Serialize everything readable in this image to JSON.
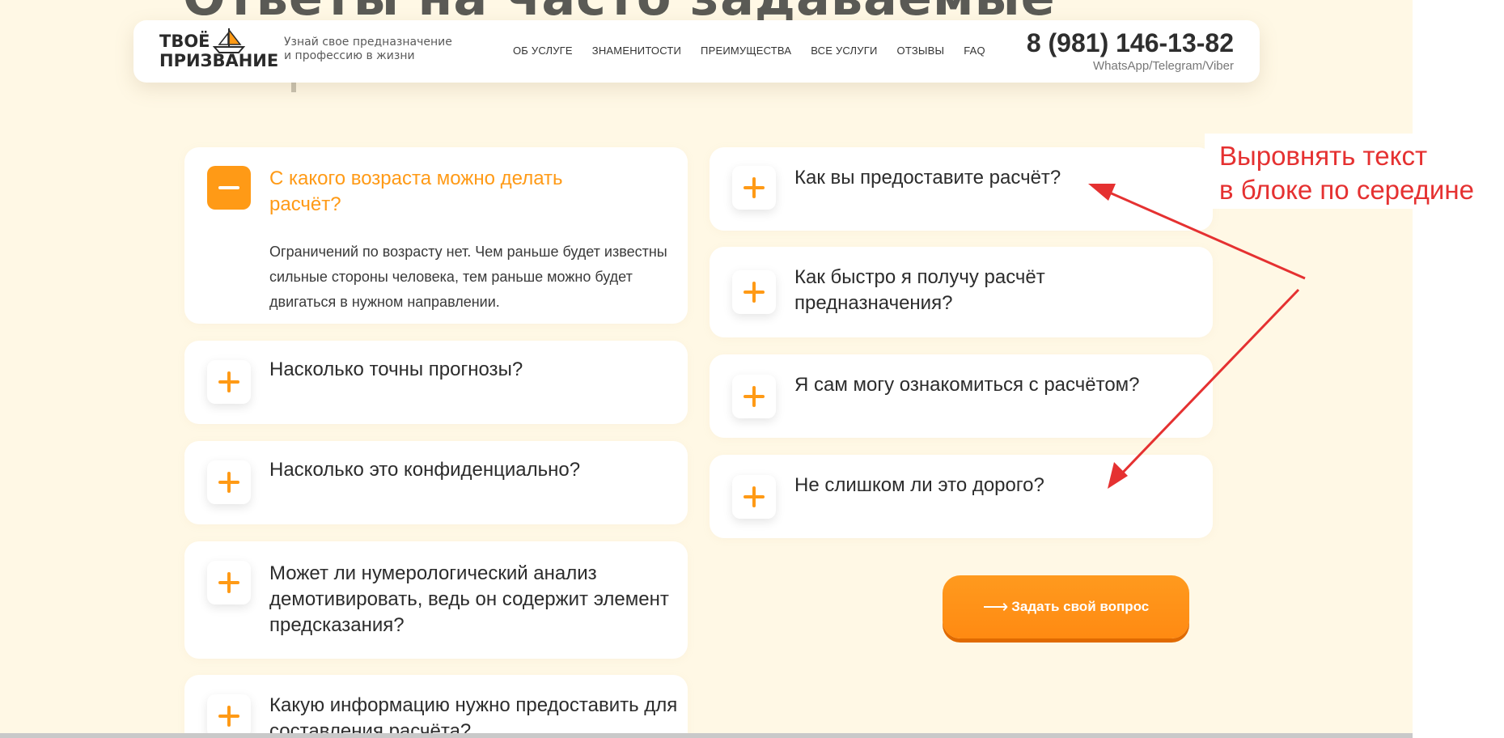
{
  "section_title": "Ответы на часто задаваемые",
  "header": {
    "logo_line1": "ТВОЁ",
    "logo_line2": "ПРИЗВАНИЕ",
    "tagline_line1": "Узнай свое предназначение",
    "tagline_line2": "и профессию в жизни",
    "nav": [
      "ОБ УСЛУГЕ",
      "ЗНАМЕНИТОСТИ",
      "ПРЕИМУЩЕСТВА",
      "ВСЕ УСЛУГИ",
      "ОТЗЫВЫ",
      "FAQ"
    ],
    "phone": "8 (981) 146-13-82",
    "messengers": "WhatsApp/Telegram/Viber"
  },
  "faq_left": [
    {
      "question": "С какого возраста можно делать расчёт?",
      "answer": "Ограничений по возрасту нет. Чем раньше будет известны сильные стороны человека, тем раньше можно будет двигаться в нужном направлении.",
      "expanded": true
    },
    {
      "question": "Насколько точны прогнозы?",
      "expanded": false
    },
    {
      "question": "Насколько это конфиденциально?",
      "expanded": false
    },
    {
      "question": "Может ли нумерологический анализ демотивировать, ведь он содержит элемент предсказания?",
      "expanded": false
    },
    {
      "question": "Какую информацию нужно предоставить для составления расчёта?",
      "expanded": false
    }
  ],
  "faq_right": [
    {
      "question": "Как вы предоставите расчёт?",
      "expanded": false
    },
    {
      "question": "Как быстро я получу расчёт предназначения?",
      "expanded": false
    },
    {
      "question": "Я сам могу ознакомиться с расчётом?",
      "expanded": false
    },
    {
      "question": "Не слишком ли это дорого?",
      "expanded": false
    }
  ],
  "ask_button": {
    "arrow": "⟶",
    "label": "Задать свой вопрос"
  },
  "annotation": {
    "line1": "Выровнять текст",
    "line2": "в блоке по середине",
    "color": "#e53131"
  },
  "colors": {
    "accent": "#ff9a16",
    "page_bg": "#fff8e5"
  }
}
